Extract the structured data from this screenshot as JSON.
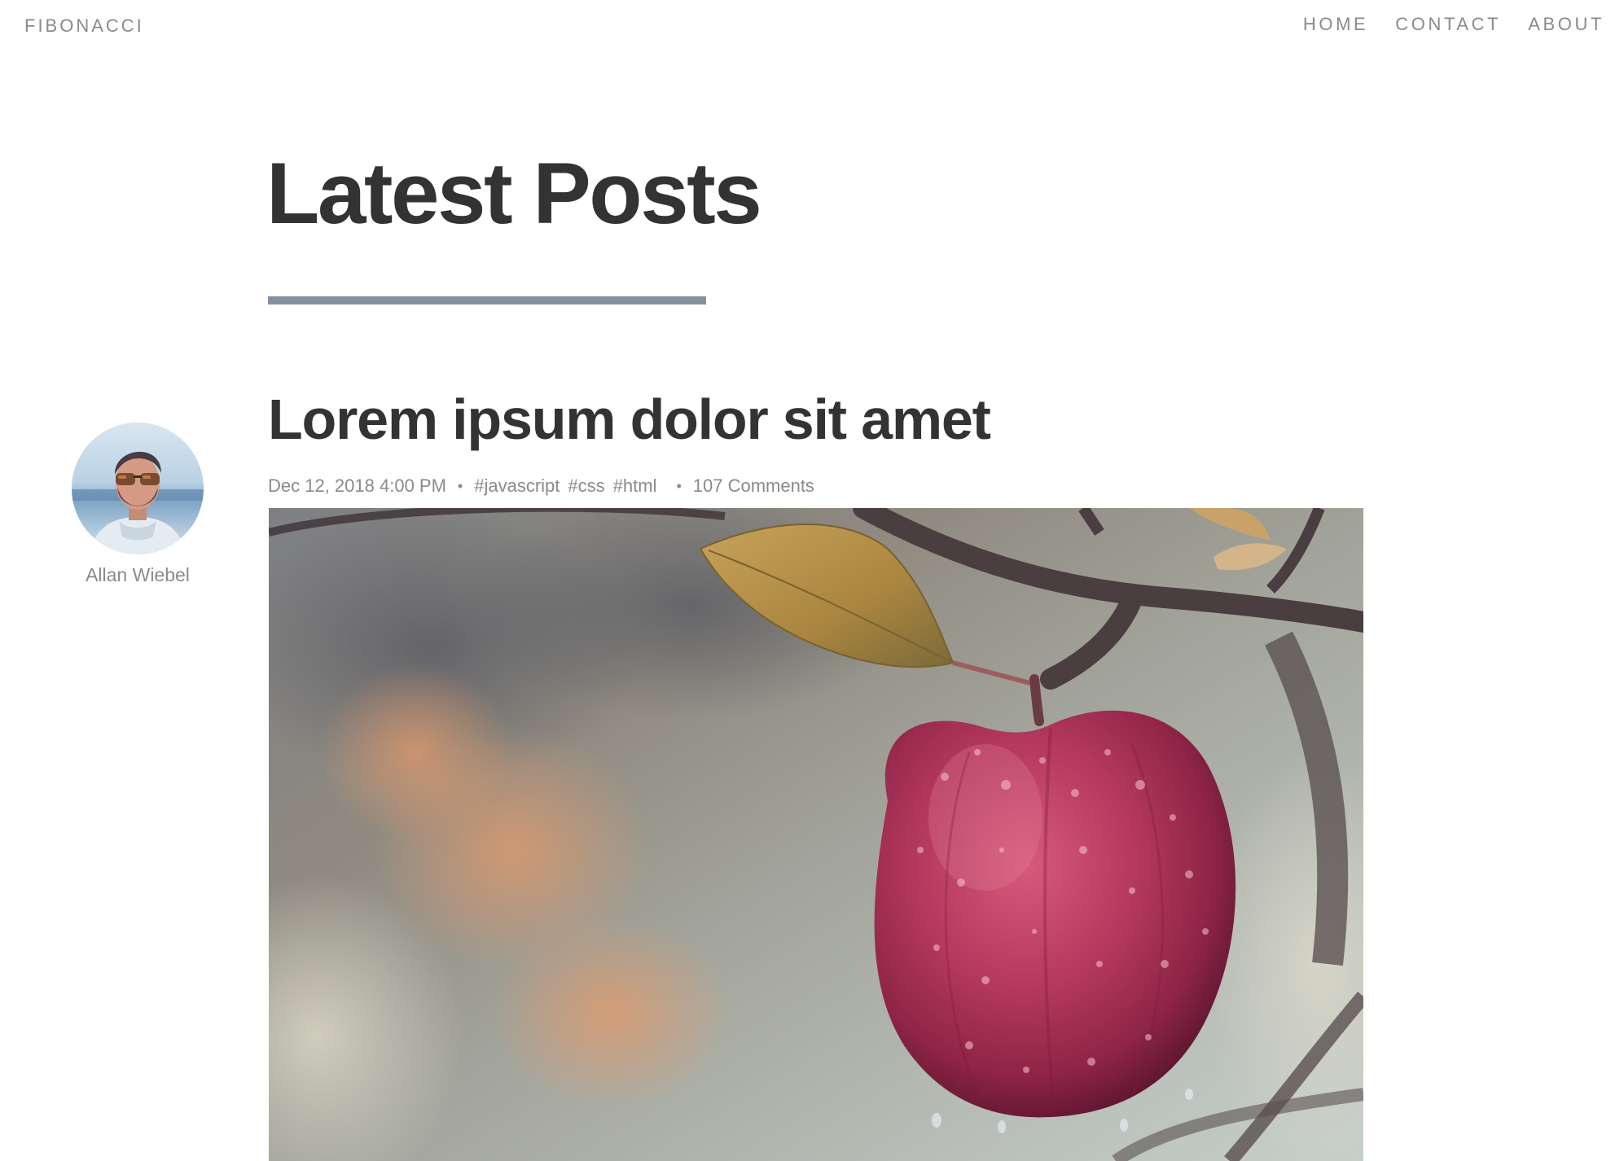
{
  "header": {
    "brand": "FIBONACCI",
    "nav": [
      "HOME",
      "CONTACT",
      "ABOUT"
    ]
  },
  "page": {
    "title": "Latest Posts"
  },
  "author": {
    "name": "Allan Wiebel"
  },
  "post": {
    "title": "Lorem ipsum dolor sit amet",
    "date": "Dec 12, 2018 4:00 PM",
    "separator": "•",
    "tags": [
      "#javascript",
      "#css",
      "#html"
    ],
    "comments": "107 Comments"
  },
  "colors": {
    "text_dark": "#333333",
    "text_muted": "#8a8a8a",
    "accent_rule": "#84909e",
    "background": "#ffffff"
  },
  "icons": {
    "avatar": "person-portrait",
    "post_image": "red-apple-on-branch-photo"
  }
}
